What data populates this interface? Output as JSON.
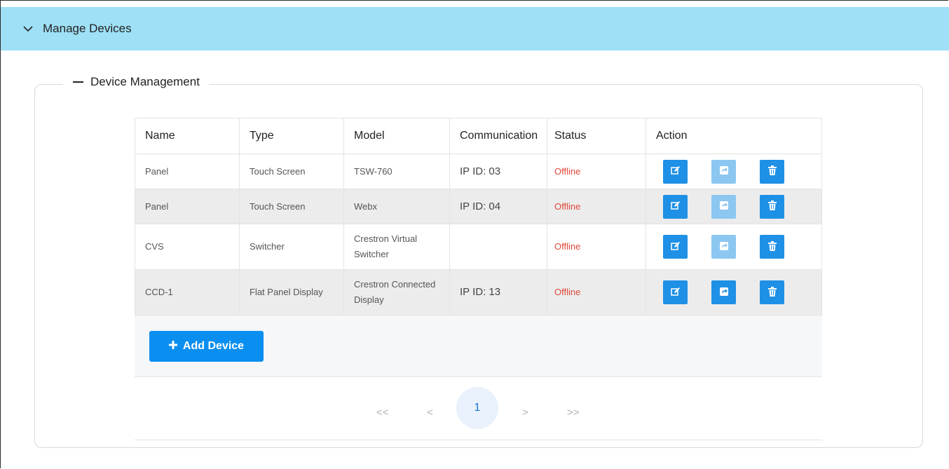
{
  "header": {
    "title": "Manage Devices",
    "icon": "chevron-down-icon"
  },
  "section": {
    "title": "Device Management",
    "icon": "minus-icon"
  },
  "table": {
    "columns": [
      "Name",
      "Type",
      "Model",
      "Communication",
      "Status",
      "Action"
    ],
    "rows": [
      {
        "name": "Panel",
        "type": "Touch Screen",
        "model": "TSW-760",
        "communication": "IP ID: 03",
        "status": "Offline"
      },
      {
        "name": "Panel",
        "type": "Touch Screen",
        "model": "Webx",
        "communication": "IP ID: 04",
        "status": "Offline"
      },
      {
        "name": "CVS",
        "type": "Switcher",
        "model": "Crestron Virtual Switcher",
        "communication": "",
        "status": "Offline"
      },
      {
        "name": "CCD-1",
        "type": "Flat Panel Display",
        "model": "Crestron Connected Display",
        "communication": "IP ID: 13",
        "status": "Offline"
      }
    ]
  },
  "actions": {
    "edit_icon": "edit-icon",
    "share_icon": "share-icon",
    "delete_icon": "trash-icon"
  },
  "add_button": {
    "label": "Add Device",
    "icon": "plus-icon"
  },
  "pagination": {
    "first": "<<",
    "prev": "<",
    "current": "1",
    "next": ">",
    "last": ">>"
  },
  "colors": {
    "header_bg": "#9ee0f6",
    "primary": "#1e90e6",
    "primary_disabled": "#8cc7f1",
    "offline": "#e0493b"
  }
}
